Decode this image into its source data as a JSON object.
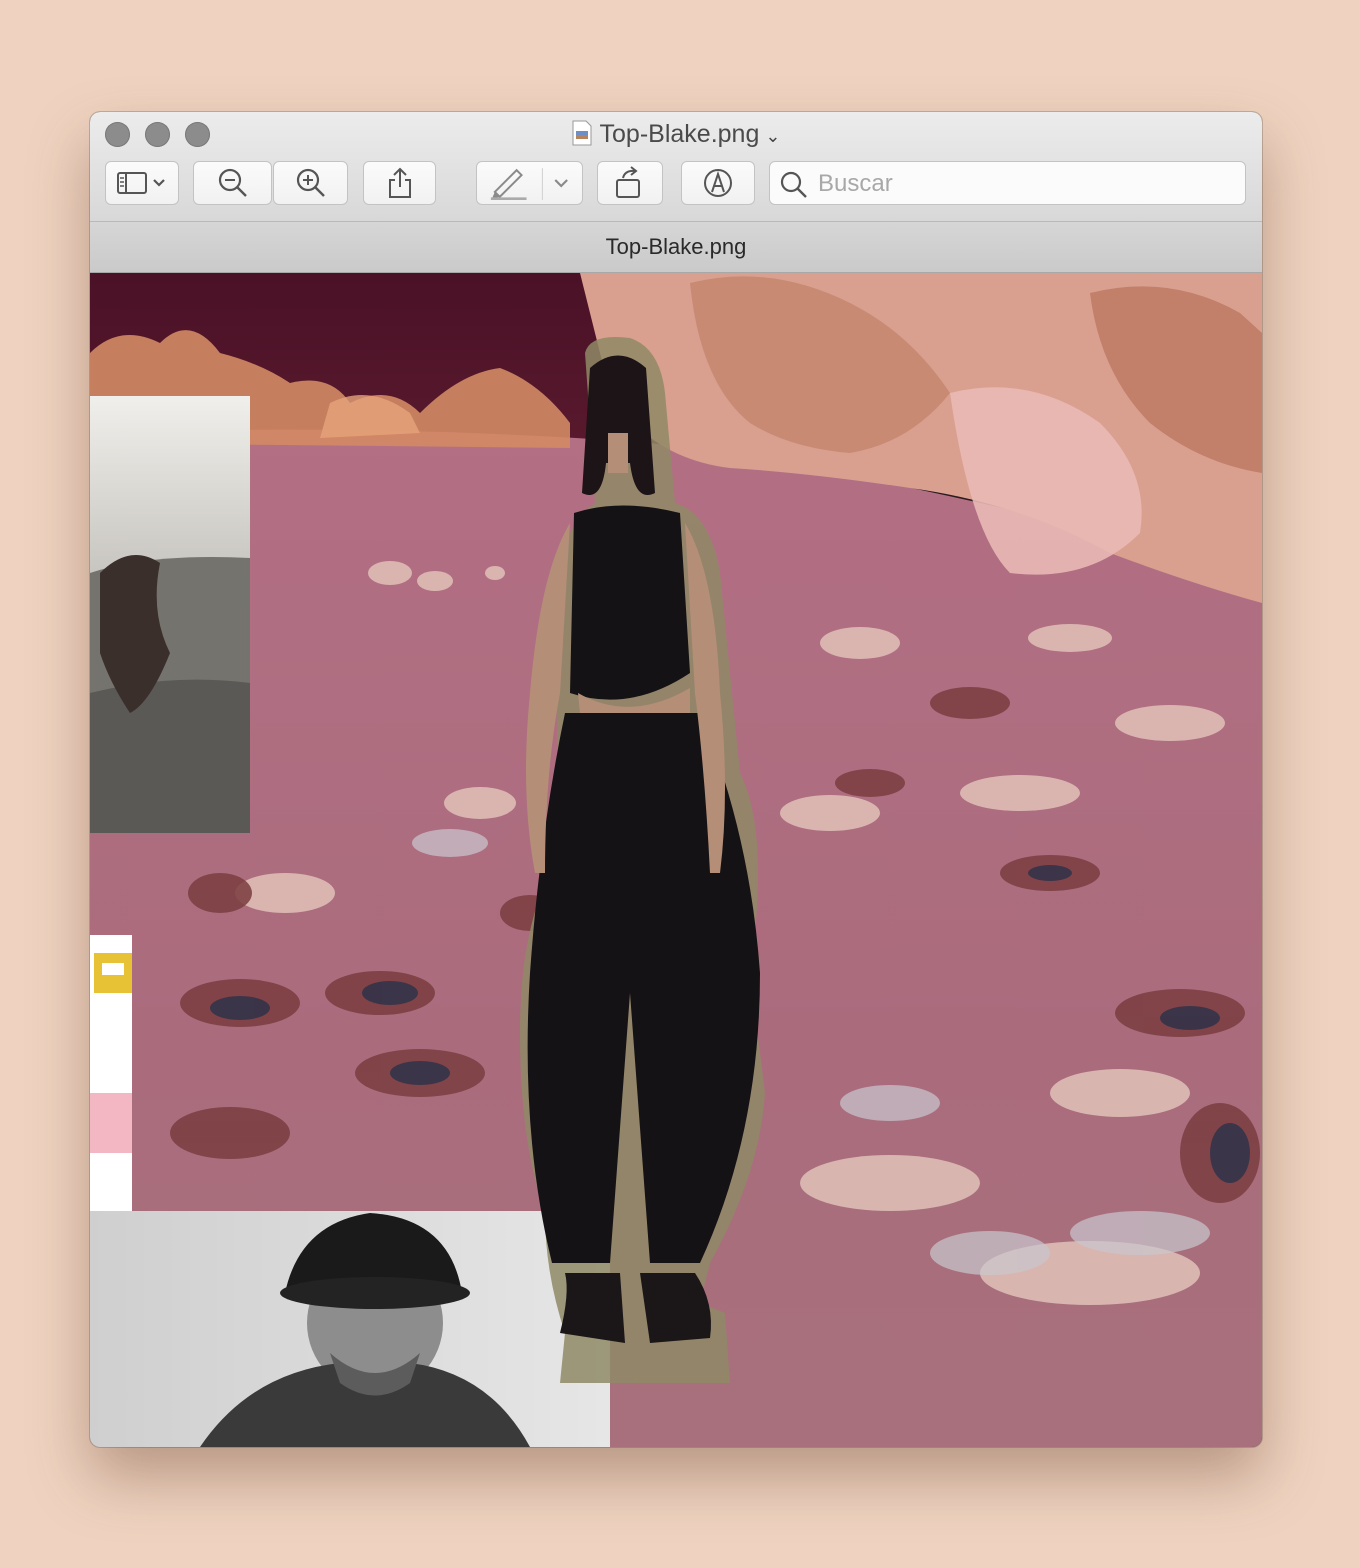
{
  "window": {
    "title": "Top-Blake.png",
    "tab_title": "Top-Blake.png"
  },
  "toolbar": {
    "sidebar_button": "sidebar-icon",
    "zoom_out_button": "zoom-out-icon",
    "zoom_in_button": "zoom-in-icon",
    "share_button": "share-icon",
    "markup_button": "pen-icon",
    "rotate_button": "rotate-icon",
    "annotate_button": "markup-icon"
  },
  "search": {
    "placeholder": "Buscar"
  },
  "image": {
    "description_colors": {
      "sky": "#4a1325",
      "field": "#b0707f",
      "trees": "#d99b7f",
      "outfit": "#141214"
    }
  }
}
